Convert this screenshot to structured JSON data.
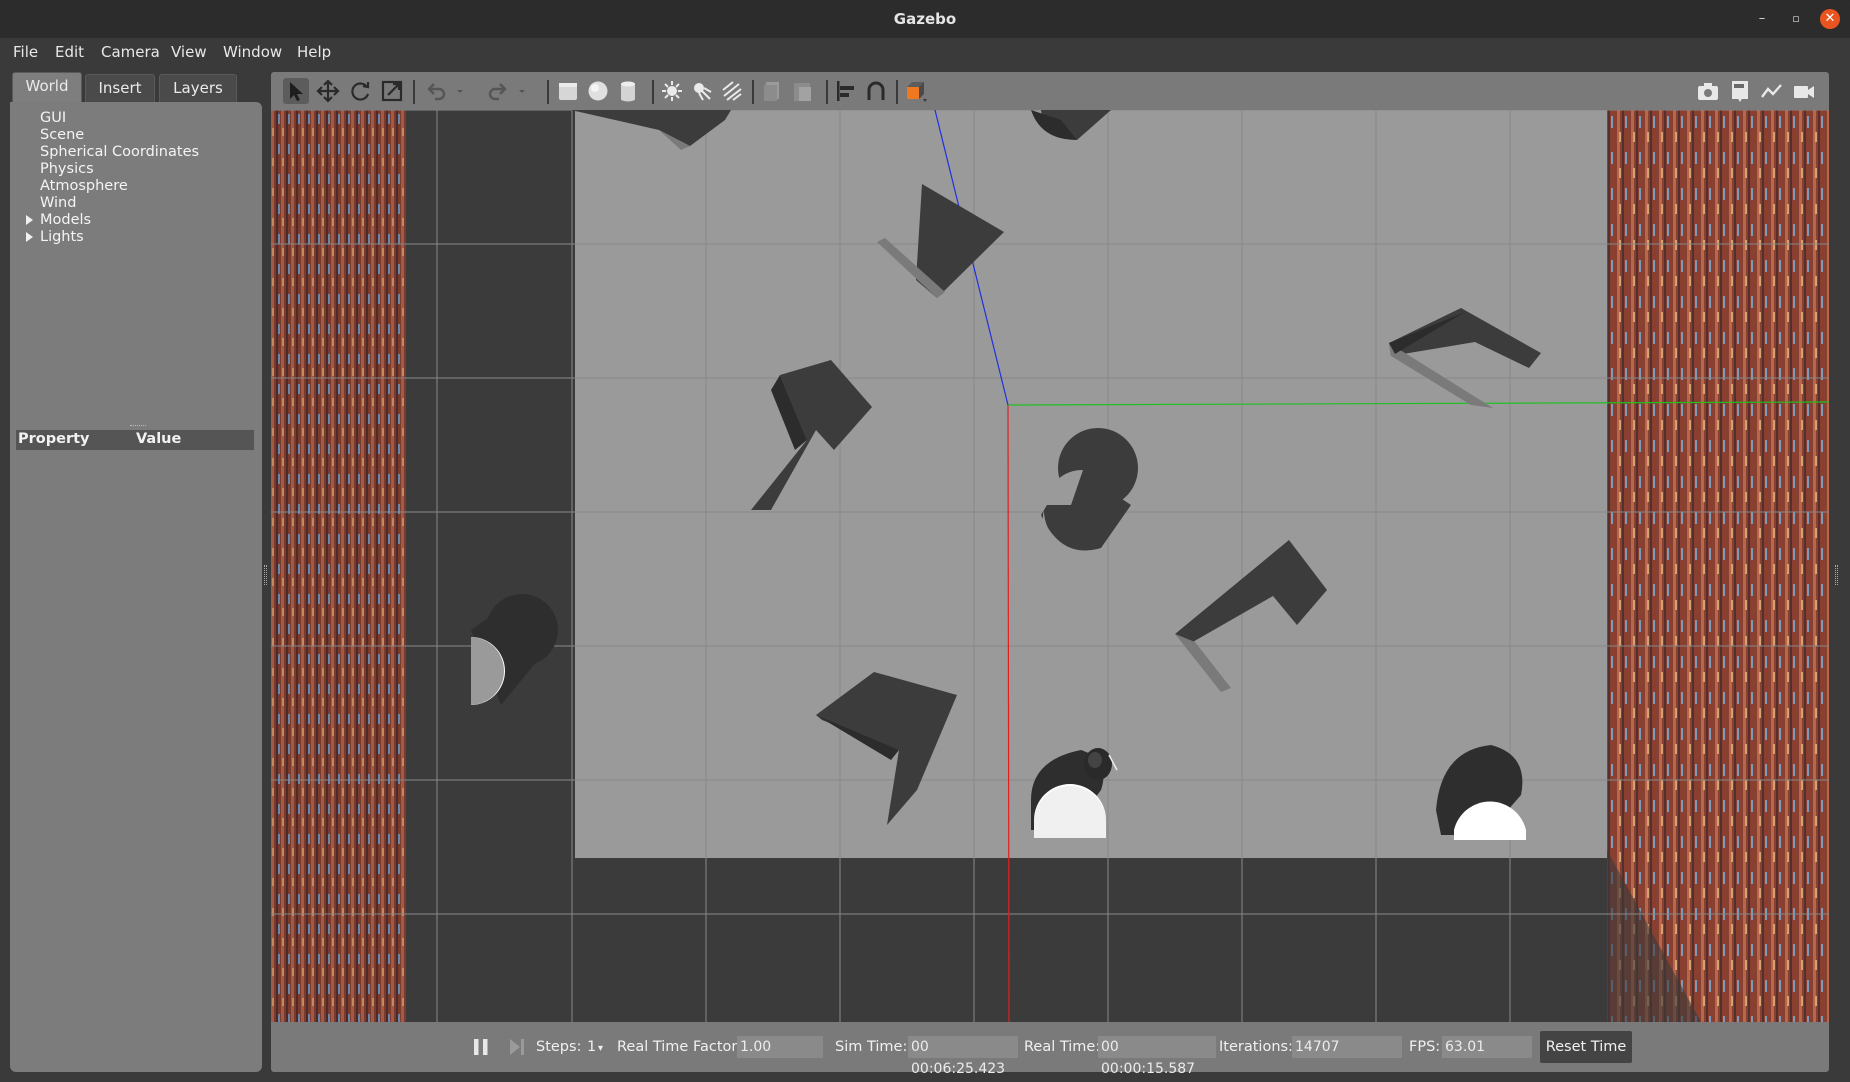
{
  "window": {
    "title": "Gazebo",
    "minimize_glyph": "–",
    "maximize_glyph": "▫",
    "close_glyph": "✕"
  },
  "menu": [
    "File",
    "Edit",
    "Camera",
    "View",
    "Window",
    "Help"
  ],
  "tabs": {
    "world": "World",
    "insert": "Insert",
    "layers": "Layers",
    "active": "World"
  },
  "tree": {
    "items": [
      {
        "label": "GUI",
        "expandable": false
      },
      {
        "label": "Scene",
        "expandable": false
      },
      {
        "label": "Spherical Coordinates",
        "expandable": false
      },
      {
        "label": "Physics",
        "expandable": false
      },
      {
        "label": "Atmosphere",
        "expandable": false
      },
      {
        "label": "Wind",
        "expandable": false
      },
      {
        "label": "Models",
        "expandable": true
      },
      {
        "label": "Lights",
        "expandable": true
      }
    ]
  },
  "properties": {
    "col_property": "Property",
    "col_value": "Value"
  },
  "toolbar": {
    "tools": [
      "select-icon",
      "translate-icon",
      "rotate-icon",
      "scale-icon",
      "undo-icon",
      "redo-icon",
      "box-icon",
      "sphere-icon",
      "cylinder-icon",
      "point-light-icon",
      "spot-light-icon",
      "directional-light-icon",
      "copy-icon",
      "paste-icon",
      "align-icon",
      "snap-icon",
      "view-angle-icon",
      "screenshot-icon",
      "log-icon",
      "plot-icon",
      "record-icon"
    ],
    "active_tool": "select-icon"
  },
  "status": {
    "steps_label": "Steps:",
    "steps_value": "1",
    "rtf_label": "Real Time Factor:",
    "rtf_value": "1.00",
    "sim_time_label": "Sim Time:",
    "sim_time_value": "00 00:06:25.423",
    "real_time_label": "Real Time:",
    "real_time_value": "00 00:00:15.587",
    "iterations_label": "Iterations:",
    "iterations_value": "14707",
    "fps_label": "FPS:",
    "fps_value": "63.01",
    "reset_label": "Reset Time"
  },
  "scene": {
    "colors": {
      "ground": "#3b3b3b",
      "floor": "#9a9a9a",
      "obstacle": "#3c3c3c",
      "obstacle_light": "#7a7a7a",
      "axis_x": "#e02020",
      "axis_y": "#20c020",
      "axis_z": "#2030e0"
    }
  }
}
